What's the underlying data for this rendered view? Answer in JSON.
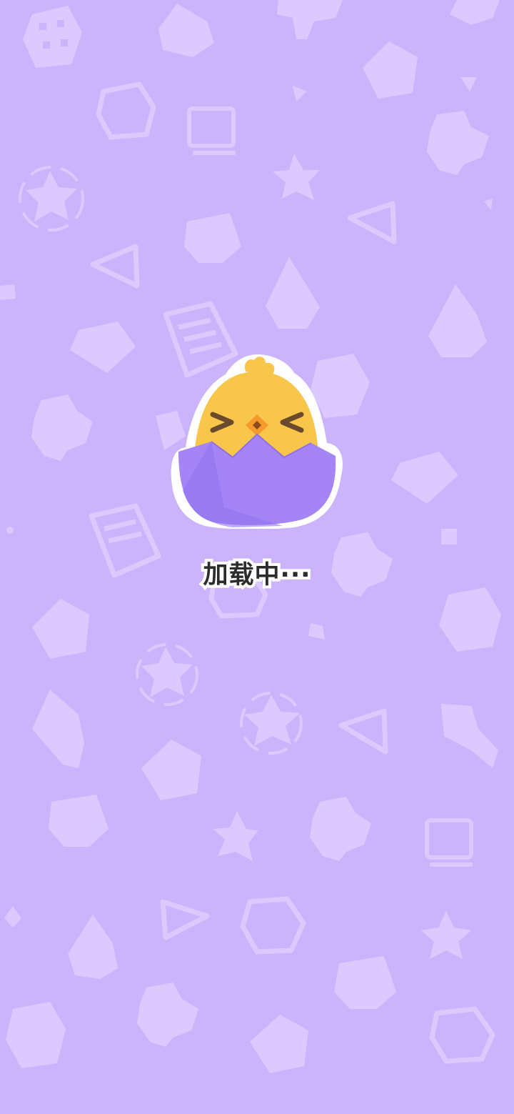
{
  "loading": {
    "text": "加载中···"
  },
  "colors": {
    "background": "#cbb4fb",
    "pattern": "#dccaff",
    "mascot_body": "#f7c64a",
    "egg_shell": "#a585f5",
    "beak": "#f59a2a",
    "text": "#2c2c2c"
  },
  "icons": [
    "dice-icon",
    "pentagon-icon",
    "star-icon",
    "flower-icon",
    "triangle-icon",
    "quote-bubble-icon",
    "document-icon",
    "drop-icon",
    "tv-icon",
    "gem-icon",
    "fishbone-icon",
    "chick-in-egg-icon"
  ]
}
